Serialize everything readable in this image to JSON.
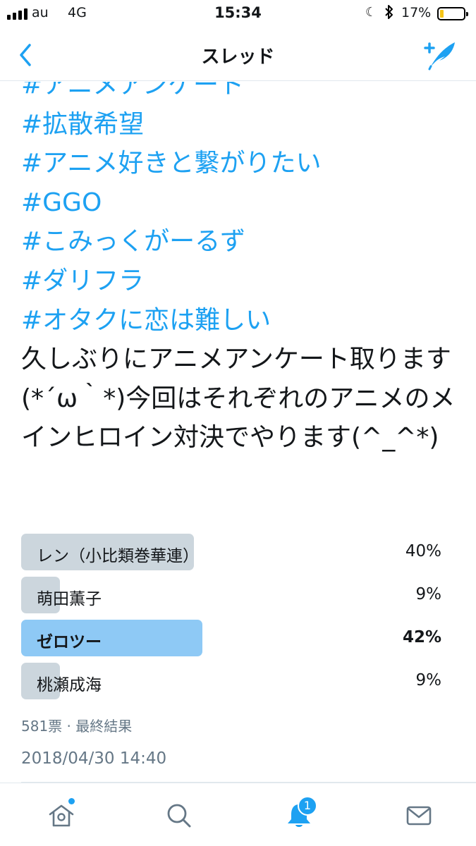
{
  "status_bar": {
    "carrier": "au",
    "network": "4G",
    "time": "15:34",
    "battery_percent": "17%",
    "battery_level": 0.17,
    "icons": [
      "signal-icon",
      "moon-icon",
      "bluetooth-icon",
      "battery-icon"
    ]
  },
  "nav": {
    "title": "スレッド",
    "back_icon": "chevron-left-icon",
    "compose_icon": "compose-tweet-icon"
  },
  "tweet": {
    "hashtags": [
      "#アニメアンケート",
      "#拡散希望",
      "#アニメ好きと繋がりたい",
      "#GGO",
      "#こみっくがーるず",
      "#ダリフラ",
      "#オタクに恋は難しい"
    ],
    "body": "久しぶりにアニメアンケート取ります(*´ω｀*)今回はそれぞれのアニメのメインヒロイン対決でやります(^_^*)",
    "poll": {
      "options": [
        {
          "label": "レン（小比類巻華連）",
          "percent": "40%",
          "value": 40
        },
        {
          "label": "萌田薫子",
          "percent": "9%",
          "value": 9
        },
        {
          "label": "ゼロツー",
          "percent": "42%",
          "value": 42
        },
        {
          "label": "桃瀬成海",
          "percent": "9%",
          "value": 9
        }
      ],
      "winner_index": 2,
      "meta": "581票 · 最終結果"
    },
    "timestamp": "2018/04/30 14:40"
  },
  "tab_bar": {
    "items": [
      {
        "icon": "home-icon",
        "has_dot": true
      },
      {
        "icon": "search-icon"
      },
      {
        "icon": "notifications-icon",
        "badge": "1"
      },
      {
        "icon": "messages-icon"
      }
    ]
  },
  "colors": {
    "accent": "#1da1f2",
    "poll_bar": "#ccd6dd",
    "poll_bar_winner": "#8ec9f5",
    "muted_text": "#657786"
  }
}
